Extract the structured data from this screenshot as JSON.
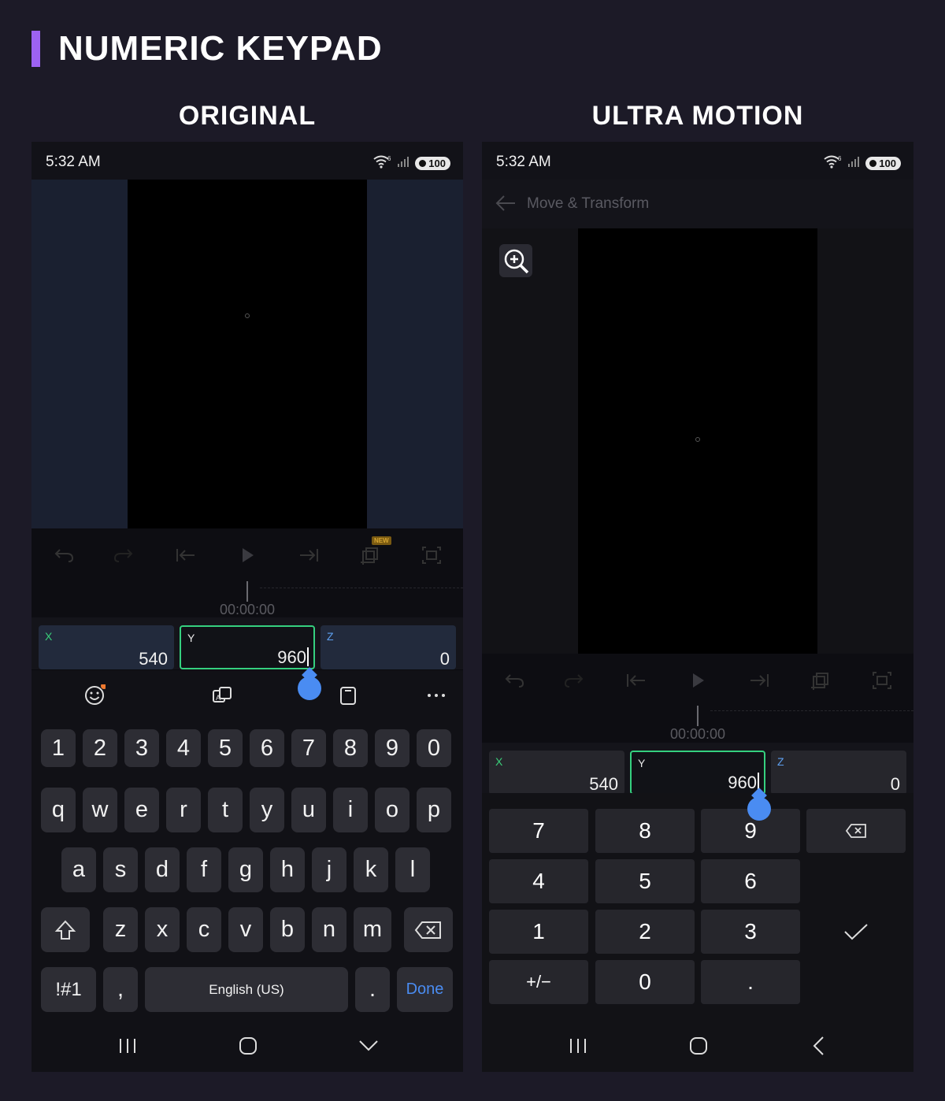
{
  "page": {
    "title": "NUMERIC KEYPAD"
  },
  "columns": {
    "original": "ORIGINAL",
    "ultra": "ULTRA MOTION"
  },
  "status": {
    "time": "5:32 AM",
    "battery": "100",
    "wifi_badge": "6"
  },
  "app_header": {
    "title": "Move & Transform"
  },
  "editor": {
    "timecode": "00:00:00",
    "new_badge": "NEW",
    "fields": [
      {
        "label": "X",
        "value": "540"
      },
      {
        "label": "Y",
        "value": "960"
      },
      {
        "label": "Z",
        "value": "0"
      }
    ]
  },
  "keyboard": {
    "digits": [
      "1",
      "2",
      "3",
      "4",
      "5",
      "6",
      "7",
      "8",
      "9",
      "0"
    ],
    "row1": [
      "q",
      "w",
      "e",
      "r",
      "t",
      "y",
      "u",
      "i",
      "o",
      "p"
    ],
    "row2": [
      "a",
      "s",
      "d",
      "f",
      "g",
      "h",
      "j",
      "k",
      "l"
    ],
    "row3": [
      "z",
      "x",
      "c",
      "v",
      "b",
      "n",
      "m"
    ],
    "symbols": "!#1",
    "comma": ",",
    "space": "English (US)",
    "period": ".",
    "done": "Done"
  },
  "numpad": {
    "keys": [
      "7",
      "8",
      "9",
      "4",
      "5",
      "6",
      "1",
      "2",
      "3",
      "0",
      "."
    ],
    "plus_minus": "+/−"
  },
  "colors": {
    "accent": "#9d62f2",
    "selected_border": "#35d07f",
    "handle": "#4a8cf2"
  }
}
